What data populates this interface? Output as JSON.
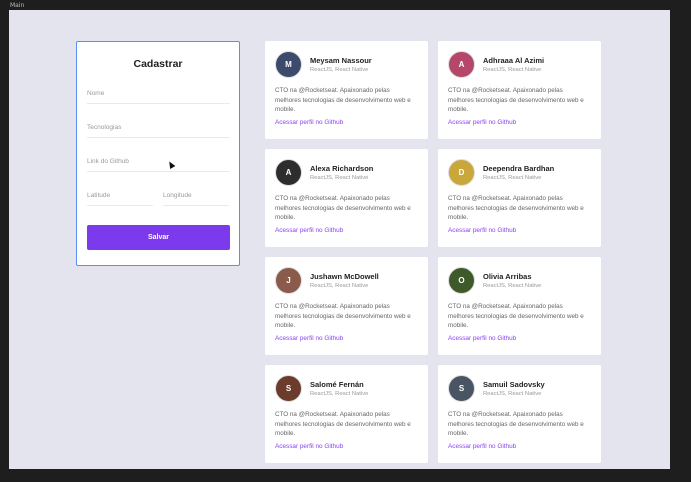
{
  "frame": {
    "label": "Main"
  },
  "form": {
    "title": "Cadastrar",
    "fields": {
      "name_placeholder": "Nome",
      "techs_placeholder": "Tecnologias",
      "github_placeholder": "Link do Github",
      "latitude_placeholder": "Latitude",
      "longitude_placeholder": "Longitude"
    },
    "save_label": "Salvar"
  },
  "colors": {
    "accent": "#7c3aed",
    "link": "#8b43f0",
    "focus_border": "#5b8ff0",
    "background": "#e4e4ee"
  },
  "devs": [
    {
      "name": "Meysam Nassour",
      "techs": "ReactJS, React Native",
      "bio": "CTO na @Rocketseat. Apaixonado pelas melhores tecnologias de desenvolvimento web e mobile.",
      "link": "Acessar perfil no Github",
      "avatar_color": "#3c4a6b",
      "avatar_initial": "M"
    },
    {
      "name": "Adhraaa Al Azimi",
      "techs": "ReactJS, React Native",
      "bio": "CTO na @Rocketseat. Apaixonado pelas melhores tecnologias de desenvolvimento web e mobile.",
      "link": "Acessar perfil no Github",
      "avatar_color": "#b4476a",
      "avatar_initial": "A"
    },
    {
      "name": "Alexa Richardson",
      "techs": "ReactJS, React Native",
      "bio": "CTO na @Rocketseat. Apaixonado pelas melhores tecnologias de desenvolvimento web e mobile.",
      "link": "Acessar perfil no Github",
      "avatar_color": "#2d2d2d",
      "avatar_initial": "A"
    },
    {
      "name": "Deependra Bardhan",
      "techs": "ReactJS, React Native",
      "bio": "CTO na @Rocketseat. Apaixonado pelas melhores tecnologias de desenvolvimento web e mobile.",
      "link": "Acessar perfil no Github",
      "avatar_color": "#c9a73b",
      "avatar_initial": "D"
    },
    {
      "name": "Jushawn McDowell",
      "techs": "ReactJS, React Native",
      "bio": "CTO na @Rocketseat. Apaixonado pelas melhores tecnologias de desenvolvimento web e mobile.",
      "link": "Acessar perfil no Github",
      "avatar_color": "#8a5a4a",
      "avatar_initial": "J"
    },
    {
      "name": "Olivia Arribas",
      "techs": "ReactJS, React Native",
      "bio": "CTO na @Rocketseat. Apaixonado pelas melhores tecnologias de desenvolvimento web e mobile.",
      "link": "Acessar perfil no Github",
      "avatar_color": "#3e5a2a",
      "avatar_initial": "O"
    },
    {
      "name": "Salomé Fernán",
      "techs": "ReactJS, React Native",
      "bio": "CTO na @Rocketseat. Apaixonado pelas melhores tecnologias de desenvolvimento web e mobile.",
      "link": "Acessar perfil no Github",
      "avatar_color": "#6b3b2b",
      "avatar_initial": "S"
    },
    {
      "name": "Samuil Sadovsky",
      "techs": "ReactJS, React Native",
      "bio": "CTO na @Rocketseat. Apaixonado pelas melhores tecnologias de desenvolvimento web e mobile.",
      "link": "Acessar perfil no Github",
      "avatar_color": "#4a5563",
      "avatar_initial": "S"
    }
  ]
}
